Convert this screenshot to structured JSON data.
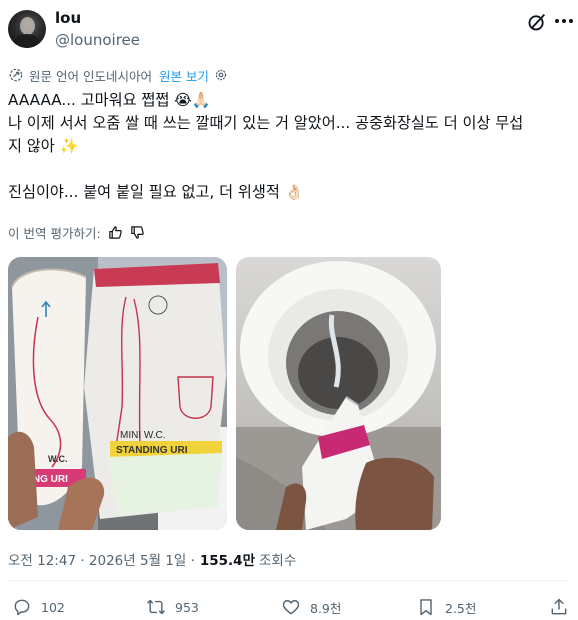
{
  "author": {
    "name": "lou",
    "handle": "@lounoiree"
  },
  "translation": {
    "notice": "원문 언어 인도네시아어",
    "view_original": "원본 보기"
  },
  "post": {
    "line1": "AAAAA... 고마워요 쩝쩝 😭🙏🏻",
    "line2": "나 이제 서서 오줌 쌀 때 쓰는 깔때기 있는 거 알았어... 공중화장실도 더 이상 무섭",
    "line3": "지 않아 ✨",
    "line4": "진심이야... 붙여 붙일 필요 없고, 더 위생적 👌🏻"
  },
  "rate_translation": "이 번역 평가하기:",
  "media": {
    "left": {
      "package_front": "MINI W.C.",
      "package_side": "STANDING URI",
      "tube_label_1": "W.C.",
      "tube_label_2": "TING URI"
    }
  },
  "meta": {
    "time": "오전 12:47 · 2026년 5월 1일 ·",
    "views": "155.4만",
    "views_label": "조회수"
  },
  "actions": {
    "replies": "102",
    "reposts": "953",
    "likes": "8.9천",
    "bookmarks": "2.5천"
  },
  "icons": [
    "grok-icon",
    "more-icon",
    "translate-icon",
    "settings-icon",
    "thumbs-up-icon",
    "thumbs-down-icon",
    "reply-icon",
    "repost-icon",
    "like-icon",
    "bookmark-icon",
    "share-icon"
  ],
  "colors": {
    "link": "#1d9bf0",
    "secondary": "#536471",
    "text": "#0f1419"
  }
}
